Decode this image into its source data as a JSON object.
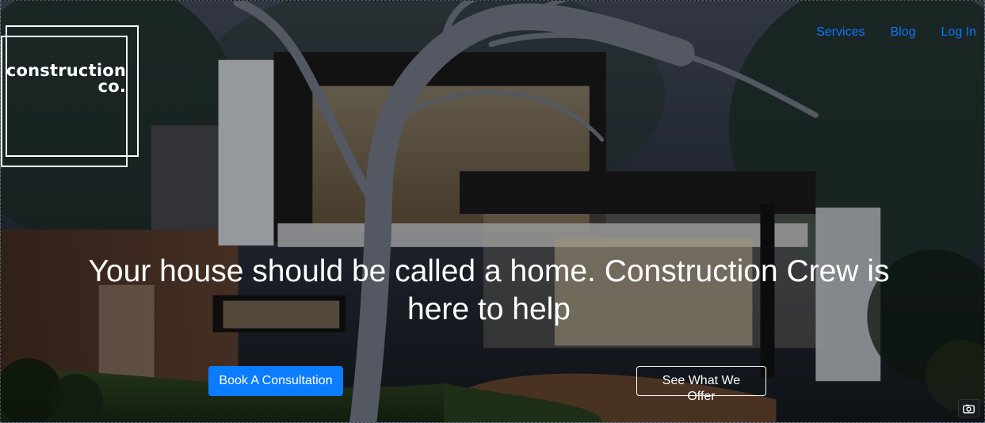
{
  "brand": {
    "line1": "construction",
    "line2": "co."
  },
  "nav": {
    "items": [
      {
        "label": "Services"
      },
      {
        "label": "Blog"
      },
      {
        "label": "Log In"
      }
    ]
  },
  "hero": {
    "headline": "Your house should be called a home. Construction Crew is here to help"
  },
  "actions": {
    "primary": "Book A Consultation",
    "secondary": "See What We Offer"
  },
  "icons": {
    "camera": "camera-icon"
  },
  "colors": {
    "link": "#0b76ff",
    "primary_button": "#0b7bff",
    "text_light": "#ffffff"
  }
}
